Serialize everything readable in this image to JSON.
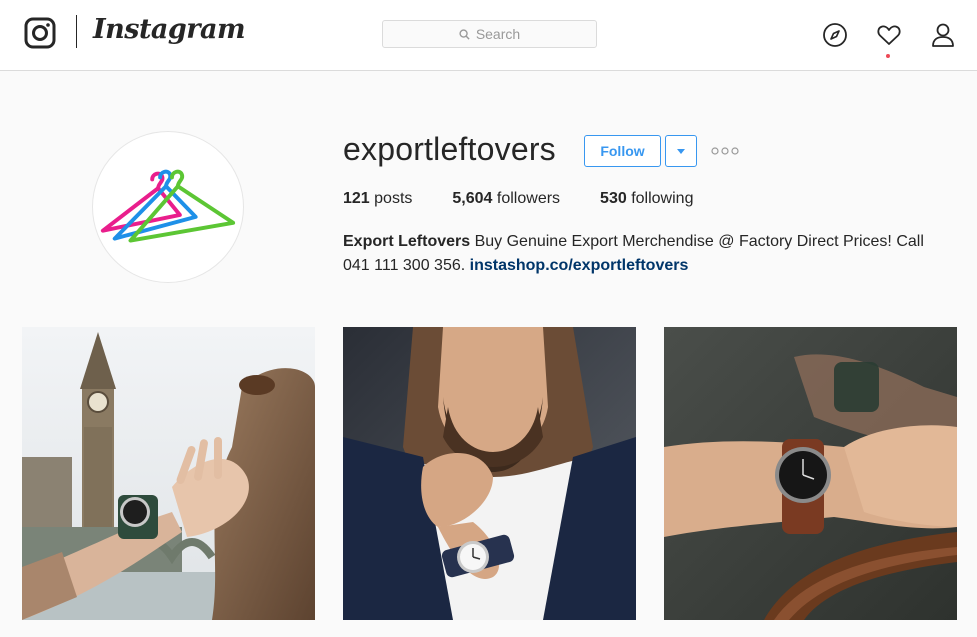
{
  "nav": {
    "brand": "Instagram",
    "search_placeholder": "Search",
    "icons": [
      "instagram-glyph-icon",
      "search-icon",
      "compass-icon",
      "heart-icon",
      "user-icon"
    ],
    "notification_dot_color": "#ed4956"
  },
  "profile": {
    "username": "exportleftovers",
    "follow_label": "Follow",
    "stats": {
      "posts_count": "121",
      "posts_label": "posts",
      "followers_count": "5,604",
      "followers_label": "followers",
      "following_count": "530",
      "following_label": "following"
    },
    "bio": {
      "full_name": "Export Leftovers",
      "text": " Buy Genuine Export Merchendise @ Factory Direct Prices! Call 041 111 300 356. ",
      "link": "instashop.co/exportleftovers"
    }
  },
  "posts": [
    {
      "description": "photo-big-ben-watch"
    },
    {
      "description": "photo-bearded-man-watch"
    },
    {
      "description": "photo-wrist-watch-closeup"
    }
  ],
  "colors": {
    "accent": "#3897f0",
    "link": "#003569",
    "border": "#dbdbdb",
    "background": "#fafafa"
  }
}
